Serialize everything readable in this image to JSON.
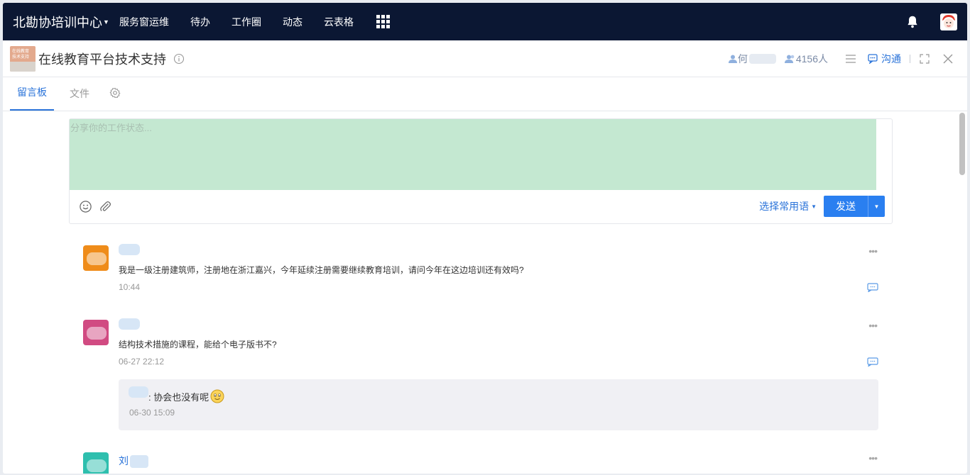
{
  "topbar": {
    "org_name": "北勘协培训中心",
    "nav": [
      "服务窗运维",
      "待办",
      "工作圈",
      "动态",
      "云表格"
    ],
    "icons": {
      "apps": "grid-icon",
      "notifications": "bell-icon",
      "user": "avatar"
    }
  },
  "group": {
    "logo_text": [
      "在线教育",
      "技术支持"
    ],
    "title": "在线教育平台技术支持",
    "member_name": "何",
    "member_count": "4156人",
    "chat_label": "沟通"
  },
  "tabs": [
    {
      "label": "留言板",
      "active": true
    },
    {
      "label": "文件",
      "active": false
    }
  ],
  "composer": {
    "placeholder": "分享你的工作状态...",
    "value": "",
    "phrase_label": "选择常用语",
    "send_label": "发送"
  },
  "posts": [
    {
      "avatar_color": "#ef8c1a",
      "text": "我是一级注册建筑师，注册地在浙江嘉兴，今年延续注册需要继续教育培训，请问今年在这边培训还有效吗?",
      "time": "10:44"
    },
    {
      "avatar_color": "#d14b82",
      "text": "结构技术措施的课程，能给个电子版书不?",
      "time": "06-27 22:12",
      "reply": {
        "text": ": 协会也没有呢",
        "time": "06-30 15:09"
      }
    },
    {
      "avatar_color": "#2ebfae",
      "name_initial": "刘"
    }
  ],
  "colors": {
    "topbar": "#0b1733",
    "accent": "#2a73d9",
    "send_button": "#2a7ff0",
    "composer_bg": "#c4e8d1"
  }
}
